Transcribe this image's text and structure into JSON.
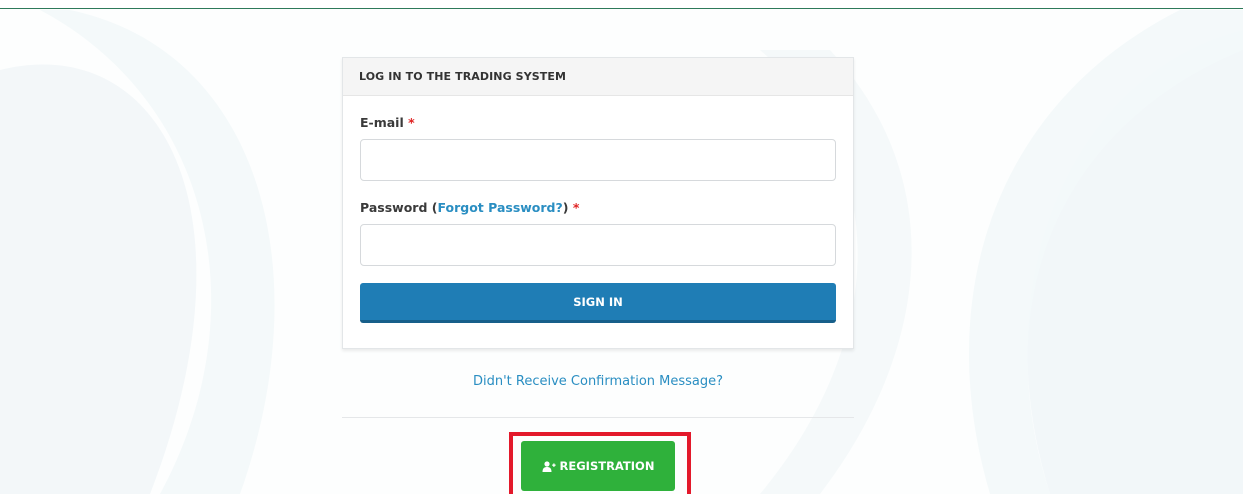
{
  "login": {
    "title": "LOG IN TO THE TRADING SYSTEM",
    "email_label": "E-mail",
    "email_value": "",
    "password_label_prefix": "Password (",
    "forgot_password_link": "Forgot Password?",
    "password_label_suffix": ")",
    "password_value": "",
    "required_marker": "*",
    "sign_in_button": "SIGN IN"
  },
  "confirmation_link": "Didn't Receive Confirmation Message?",
  "registration_button": "REGISTRATION",
  "icons": {
    "registration": "user-plus-icon"
  },
  "colors": {
    "header_rule": "#2e7a5a",
    "primary_button": "#1f7db5",
    "link": "#2a8ec2",
    "registration_button": "#2fb13b",
    "highlight": "#e3192b",
    "required": "#e02424"
  }
}
